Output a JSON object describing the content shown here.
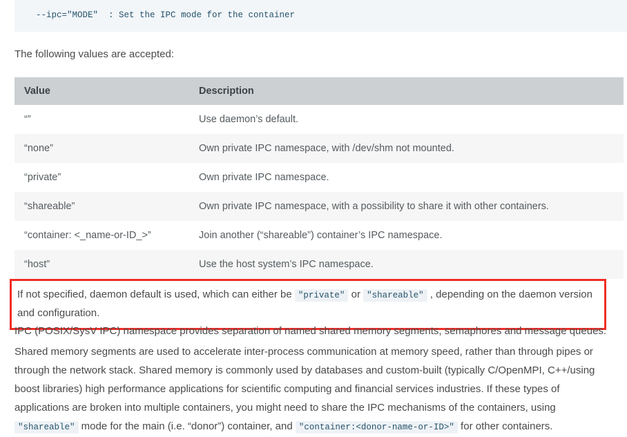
{
  "code_block": {
    "text": "  --ipc=\"MODE\"  : Set the IPC mode for the container"
  },
  "intro_text": "The following values are accepted:",
  "table": {
    "headers": [
      "Value",
      "Description"
    ],
    "rows": [
      {
        "value": "“”",
        "description": "Use daemon’s default."
      },
      {
        "value": "“none”",
        "description": "Own private IPC namespace, with /dev/shm not mounted."
      },
      {
        "value": "“private”",
        "description": "Own private IPC namespace."
      },
      {
        "value": "“shareable”",
        "description": "Own private IPC namespace, with a possibility to share it with other containers."
      },
      {
        "value": "“container: <_name-or-ID_>”",
        "description": "Join another (“shareable”) container’s IPC namespace."
      },
      {
        "value": "“host”",
        "description": "Use the host system’s IPC namespace."
      }
    ]
  },
  "note": {
    "text_part1": "If not specified, daemon default is used, which can either be ",
    "code1": "\"private\"",
    "text_part2": " or ",
    "code2": "\"shareable\"",
    "text_part3": " , depending on the daemon version and configuration.",
    "border_color": "#ef2d26"
  },
  "paragraph1": "IPC (POSIX/SysV IPC) namespace provides separation of named shared memory segments, semaphores and message queues.",
  "paragraph2": {
    "text_part1": "Shared memory segments are used to accelerate inter-process communication at memory speed, rather than through pipes or through the network stack. Shared memory is commonly used by databases and custom-built (typically C/OpenMPI, C++/using boost libraries) high performance applications for scientific computing and financial services industries. If these types of applications are broken into multiple containers, you might need to share the IPC mechanisms of the containers, using ",
    "code1": "\"shareable\"",
    "text_part2": " mode for the main (i.e. “donor”) container, and ",
    "code2": "\"container:<donor-name-or-ID>\"",
    "text_part3": " for other containers."
  },
  "colors": {
    "code_block_bg": "#f2f6f9",
    "code_text": "#26536b",
    "table_header_bg": "#ccd0d2",
    "table_stripe_bg": "#f6f6f6",
    "chip_bg": "#eef2f6",
    "body_text": "#4a4a4a"
  }
}
